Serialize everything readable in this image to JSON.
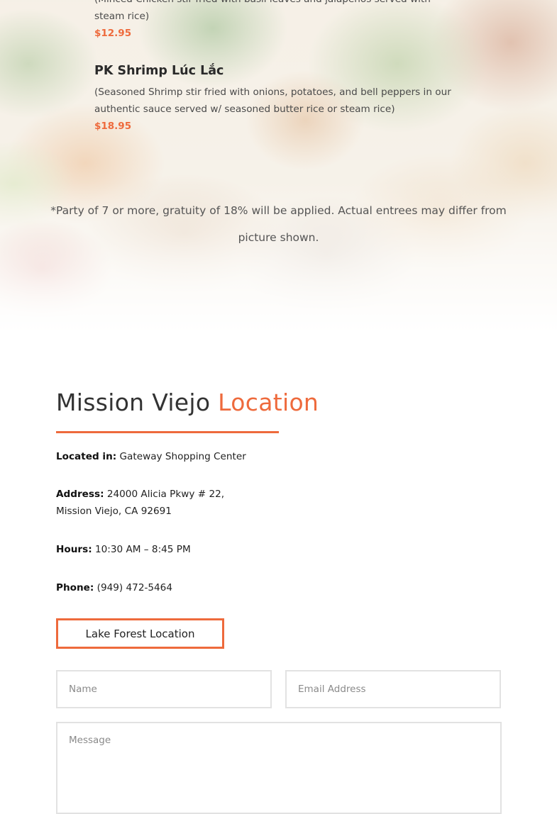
{
  "menu": {
    "items": [
      {
        "name": "",
        "description": "(Minced Chicken stir fried with basil leaves and jalapenos served with steam rice)",
        "price": "$12.95"
      },
      {
        "name": "PK Shrimp Lúc Lắc",
        "description": "(Seasoned Shrimp stir fried with onions, potatoes, and bell peppers in our authentic sauce served w/ seasoned butter rice or steam rice)",
        "price": "$18.95"
      }
    ],
    "disclaimer": "*Party of 7 or more, gratuity of 18% will be applied. Actual entrees may differ from picture shown."
  },
  "location": {
    "title_main": "Mission Viejo",
    "title_accent": "Location",
    "located_label": "Located in:",
    "located_value": "Gateway Shopping Center",
    "address_label": "Address:",
    "address_line1": "24000 Alicia Pkwy # 22,",
    "address_line2": "Mission Viejo, CA 92691",
    "hours_label": "Hours:",
    "hours_value": "10:30 AM – 8:45 PM",
    "phone_label": "Phone:",
    "phone_value": "(949) 472-5464",
    "button_label": "Lake Forest Location"
  },
  "form": {
    "name_placeholder": "Name",
    "email_placeholder": "Email Address",
    "message_placeholder": "Message"
  },
  "colors": {
    "accent": "#ee6a3c",
    "text": "#222222",
    "border": "#e2e2e2"
  }
}
